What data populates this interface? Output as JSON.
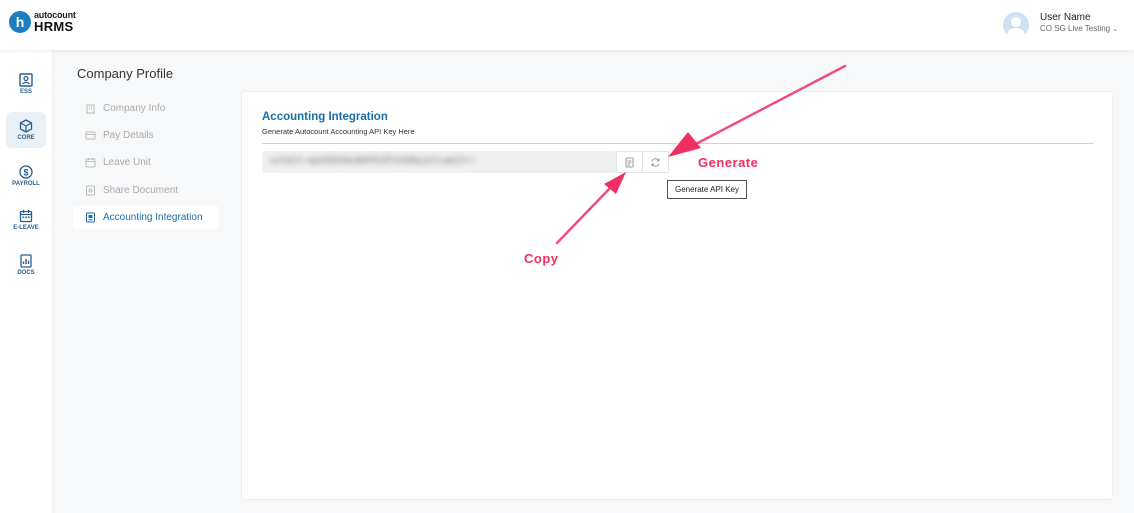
{
  "app": {
    "logo_small": "autocount",
    "logo_big": "HRMS",
    "logo_letter": "h",
    "brand_color": "#1b7ec2"
  },
  "user": {
    "name": "User Name",
    "company": "CO SG Live Testing",
    "avatar_icon": "user-avatar-icon"
  },
  "rail": [
    {
      "label": "ESS",
      "icon": "ess-icon",
      "active": false
    },
    {
      "label": "CORE",
      "icon": "core-cube-icon",
      "active": true
    },
    {
      "label": "PAYROLL",
      "icon": "dollar-icon",
      "active": false
    },
    {
      "label": "E-LEAVE",
      "icon": "calendar-icon",
      "active": false
    },
    {
      "label": "DOCS",
      "icon": "docs-icon",
      "active": false
    }
  ],
  "page": {
    "title": "Company Profile"
  },
  "menu": [
    {
      "label": "Company Info",
      "icon": "building-icon",
      "active": false
    },
    {
      "label": "Pay Details",
      "icon": "pay-icon",
      "active": false
    },
    {
      "label": "Leave Unit",
      "icon": "leave-icon",
      "active": false
    },
    {
      "label": "Share Document",
      "icon": "share-doc-icon",
      "active": false
    },
    {
      "label": "Accounting Integration",
      "icon": "integration-icon",
      "active": true
    }
  ],
  "card": {
    "title": "Accounting Integration",
    "subtitle": "Generate Autocount Accounting API Key Here",
    "api_key_masked": "uvXeC3-mpASDXHmuNbPMiRfaVmNwjeYLwm23==",
    "copy_icon": "copy-icon",
    "generate_icon": "refresh-icon",
    "tooltip": "Generate API Key"
  },
  "annotations": {
    "generate": "Generate",
    "copy": "Copy",
    "color": "#ef2f63"
  }
}
